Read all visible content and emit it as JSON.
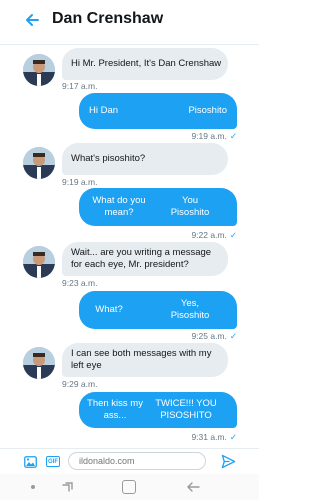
{
  "header": {
    "title": "Dan Crenshaw",
    "back_icon": "back-arrow-icon"
  },
  "colors": {
    "accent": "#1da1f2",
    "incoming_bubble": "#e6ecf0",
    "timestamp": "#657786"
  },
  "messages": [
    {
      "from": "them",
      "lines": [
        "Hi Mr. President, It's Dan Crenshaw"
      ],
      "time": "9:17 a.m."
    },
    {
      "from": "me",
      "left": "Hi Dan",
      "right": "Pisoshito",
      "time": "9:19 a.m."
    },
    {
      "from": "them",
      "lines": [
        "What's pisoshito?"
      ],
      "time": "9:19 a.m."
    },
    {
      "from": "me",
      "left": "What do you mean?",
      "right": "You Pisoshito",
      "time": "9:22 a.m."
    },
    {
      "from": "them",
      "lines": [
        "Wait... are you writing a message",
        "for each eye, Mr. president?"
      ],
      "time": "9:23 a.m."
    },
    {
      "from": "me",
      "left": "What?",
      "right": "Yes, Pisoshito",
      "time": "9:25 a.m."
    },
    {
      "from": "them",
      "lines": [
        "I can see both messages with my",
        "left eye"
      ],
      "time": "9:29 a.m."
    },
    {
      "from": "me",
      "left": "Then kiss my ass...",
      "right": "TWICE!!! YOU PISOSHITO",
      "time": "9:31 a.m."
    }
  ],
  "composer": {
    "placeholder": "ildonaldo.com",
    "icons": [
      "image-icon",
      "gif-icon",
      "send-icon"
    ]
  },
  "navbar": {
    "icons": [
      "dot-icon",
      "recent-apps-icon",
      "home-icon",
      "back-icon"
    ]
  }
}
